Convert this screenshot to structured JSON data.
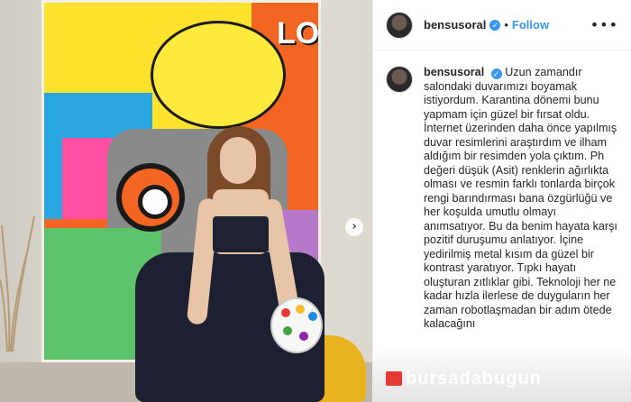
{
  "post": {
    "username": "bensusoral",
    "verified_icon": "verified-badge-icon",
    "separator": "•",
    "follow_label": "Follow",
    "more_label": "•••",
    "next_label": "›"
  },
  "photo": {
    "painting_text": "LOVE"
  },
  "caption": {
    "username": "bensusoral",
    "text": "Uzun zamandır salondaki duvarımızı boyamak istiyordum. Karantina dönemi bunu yapmam için güzel bir fırsat oldu. İnternet üzerinden daha önce yapılmış duvar resimlerini araştırdım ve ilham aldığım bir resimden yola çıktım. Ph değeri düşük (Asit) renklerin ağırlıkta olması ve resmin farklı tonlarda birçok rengi barındırması bana özgürlüğü ve her koşulda umutlu olmayı anımsatıyor. Bu da benim hayata karşı pozitif duruşumu anlatıyor. İçine yedirilmiş metal kısım da güzel bir kontrast yaratıyor. Tıpkı hayatı oluşturan zıtlıklar gibi. Teknoloji her ne kadar hızla ilerlese de duyguların her zaman robotlaşmadan bir adım ötede kalacağını"
  },
  "watermark": {
    "text": "bursadabugun"
  },
  "colors": {
    "accent": "#3897f0",
    "text": "#262626"
  }
}
